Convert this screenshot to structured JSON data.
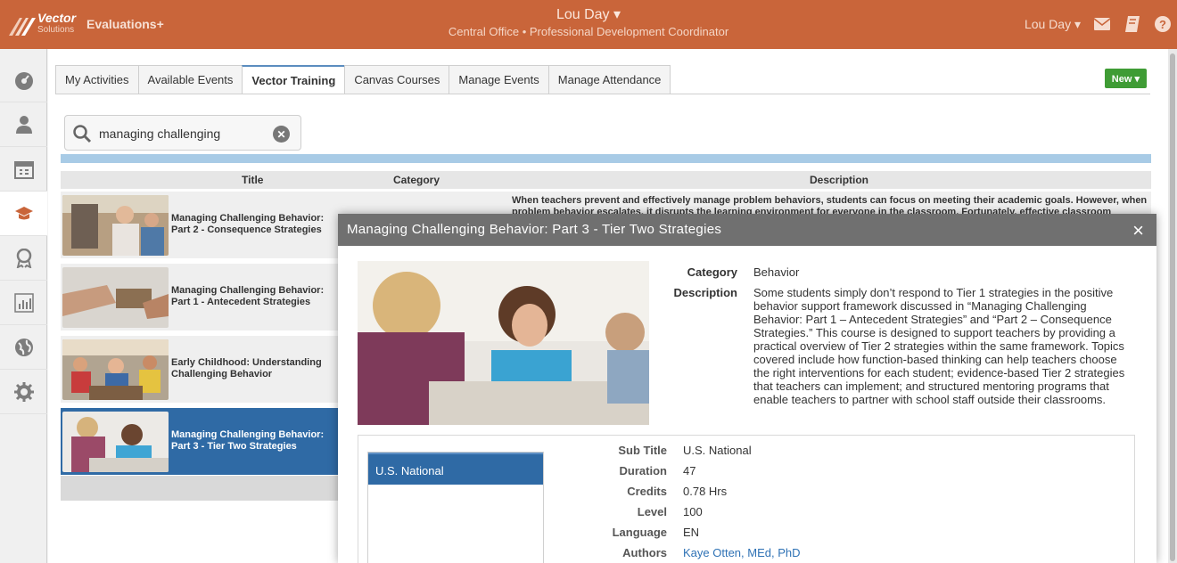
{
  "header": {
    "logo_line1": "Vector",
    "logo_line2": "Solutions",
    "app_name": "Evaluations+",
    "center_name": "Lou Day ▾",
    "center_role": "Central Office • Professional Development Coordinator",
    "user_menu": "Lou Day ▾"
  },
  "sidebar": {
    "items": [
      {
        "icon": "dashboard-icon"
      },
      {
        "icon": "user-icon"
      },
      {
        "icon": "calendar-icon"
      },
      {
        "icon": "graduation-cap-icon"
      },
      {
        "icon": "award-icon"
      },
      {
        "icon": "chart-icon"
      },
      {
        "icon": "globe-icon"
      },
      {
        "icon": "gear-icon"
      }
    ]
  },
  "tabs": [
    {
      "label": "My Activities"
    },
    {
      "label": "Available Events"
    },
    {
      "label": "Vector Training"
    },
    {
      "label": "Canvas Courses"
    },
    {
      "label": "Manage Events"
    },
    {
      "label": "Manage Attendance"
    }
  ],
  "new_button": "New ▾",
  "search": {
    "value": "managing challenging"
  },
  "table": {
    "headers": {
      "title": "Title",
      "category": "Category",
      "description": "Description"
    },
    "rows": [
      {
        "title": "Managing Challenging Behavior: Part 2 - Consequence Strategies",
        "desc": "When teachers prevent and effectively manage problem behaviors, students can focus on meeting their academic goals. However, when problem behavior escalates, it disrupts the learning environment for everyone in the classroom. Fortunately, effective classroom"
      },
      {
        "title": "Managing Challenging Behavior: Part 1 - Antecedent Strategies",
        "desc": ""
      },
      {
        "title": "Early Childhood: Understanding Challenging Behavior",
        "desc": ""
      },
      {
        "title": "Managing Challenging Behavior: Part 3 - Tier Two Strategies",
        "desc": ""
      }
    ]
  },
  "modal": {
    "title": "Managing Challenging Behavior: Part 3 - Tier Two Strategies",
    "close": "×",
    "category_label": "Category",
    "category_value": "Behavior",
    "description_label": "Description",
    "description_value": "Some students simply don’t respond to Tier 1 strategies in the positive behavior support framework discussed in “Managing Challenging Behavior: Part 1 – Antecedent Strategies” and “Part 2 – Consequence Strategies.” This course is designed to support teachers by providing a practical overview of Tier 2 strategies within the same framework. Topics covered include how function-based thinking can help teachers choose the right interventions for each student; evidence-based Tier 2 strategies that teachers can implement; and structured mentoring programs that enable teachers to partner with school staff outside their classrooms.",
    "list_selected": "U.S. National",
    "details": [
      {
        "label": "Sub Title",
        "value": "U.S. National"
      },
      {
        "label": "Duration",
        "value": "47"
      },
      {
        "label": "Credits",
        "value": "0.78 Hrs"
      },
      {
        "label": "Level",
        "value": "100"
      },
      {
        "label": "Language",
        "value": "EN"
      },
      {
        "label": "Authors",
        "value": "Kaye Otten, MEd, PhD"
      }
    ]
  },
  "colors": {
    "brand": "#c9653a",
    "selected": "#2f6aa5",
    "new_button": "#3f9c35"
  }
}
